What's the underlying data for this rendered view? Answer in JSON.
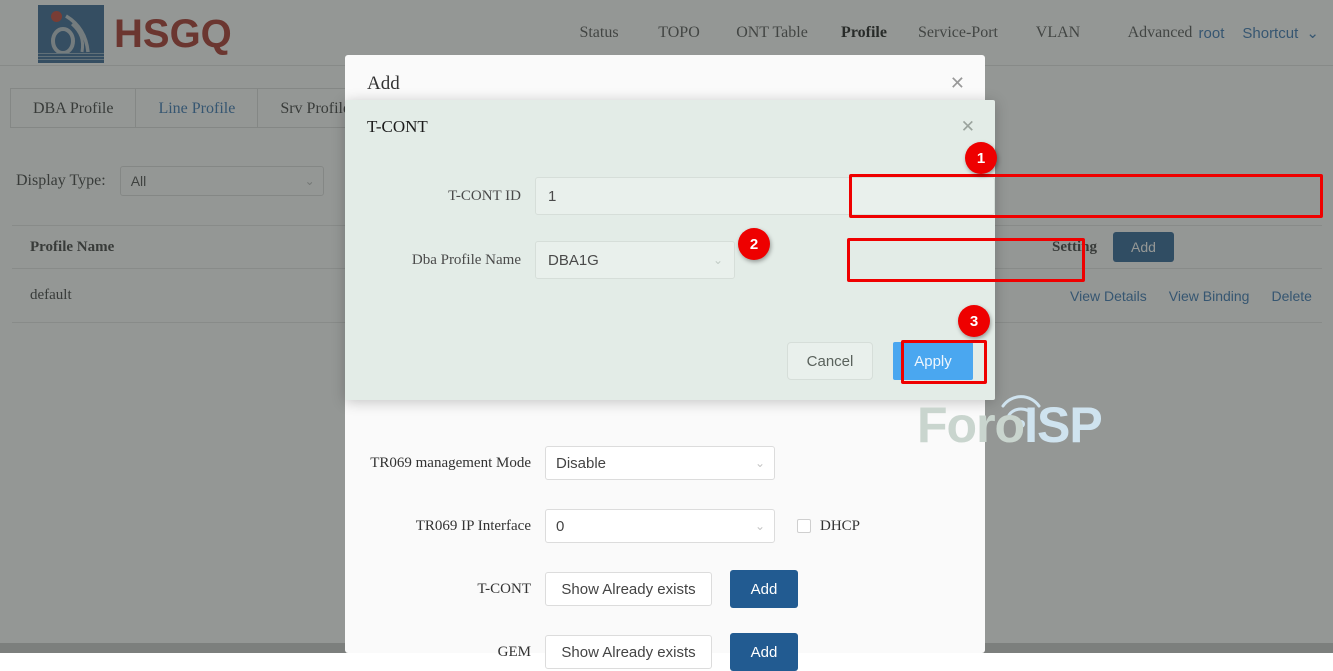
{
  "brand": {
    "name": "HSGQ",
    "logo_icon": "hsgq-logo-icon"
  },
  "topnav": {
    "items": [
      {
        "label": "Status",
        "active": false
      },
      {
        "label": "TOPO",
        "active": false
      },
      {
        "label": "ONT Table",
        "active": false
      },
      {
        "label": "Profile",
        "active": true
      },
      {
        "label": "Service-Port",
        "active": false
      },
      {
        "label": "VLAN",
        "active": false
      },
      {
        "label": "Advanced",
        "active": false
      }
    ],
    "user": "root",
    "shortcut": "Shortcut",
    "shortcut_caret_icon": "chevron-down-icon"
  },
  "tabs": [
    {
      "label": "DBA Profile",
      "active": false
    },
    {
      "label": "Line Profile",
      "active": true
    },
    {
      "label": "Srv Profile",
      "active": false
    }
  ],
  "filter": {
    "label": "Display Type:",
    "value": "All",
    "caret_icon": "chevron-down-icon"
  },
  "table": {
    "headers": {
      "profile_name": "Profile Name",
      "setting": "Setting"
    },
    "add_label": "Add",
    "rows": [
      {
        "profile_name": "default",
        "actions": [
          "View Details",
          "View Binding",
          "Delete"
        ]
      }
    ]
  },
  "add_dialog": {
    "title": "Add",
    "close_icon": "close-icon",
    "fields": [
      {
        "label": "TR069 management Mode",
        "value": "Disable",
        "type": "select"
      },
      {
        "label": "TR069 IP Interface",
        "value": "0",
        "type": "select"
      }
    ],
    "dhcp": {
      "label": "DHCP",
      "checked": false
    },
    "lists": [
      {
        "label": "T-CONT",
        "button": "Show Already exists",
        "add": "Add"
      },
      {
        "label": "GEM",
        "button": "Show Already exists",
        "add": "Add"
      }
    ]
  },
  "tcont_dialog": {
    "title": "T-CONT",
    "close_icon": "close-icon",
    "tcont_id": {
      "label": "T-CONT ID",
      "value": "1"
    },
    "dba_profile": {
      "label": "Dba Profile Name",
      "value": "DBA1G",
      "caret_icon": "chevron-down-icon"
    },
    "cancel": "Cancel",
    "apply": "Apply"
  },
  "annotations": {
    "highlight_color": "#ee0000",
    "badges": [
      {
        "number": "1",
        "target": "tcont-id-input"
      },
      {
        "number": "2",
        "target": "dba-profile-select"
      },
      {
        "number": "3",
        "target": "apply-button"
      }
    ]
  },
  "watermark": {
    "part1": "Foro",
    "part2": "ISP"
  }
}
